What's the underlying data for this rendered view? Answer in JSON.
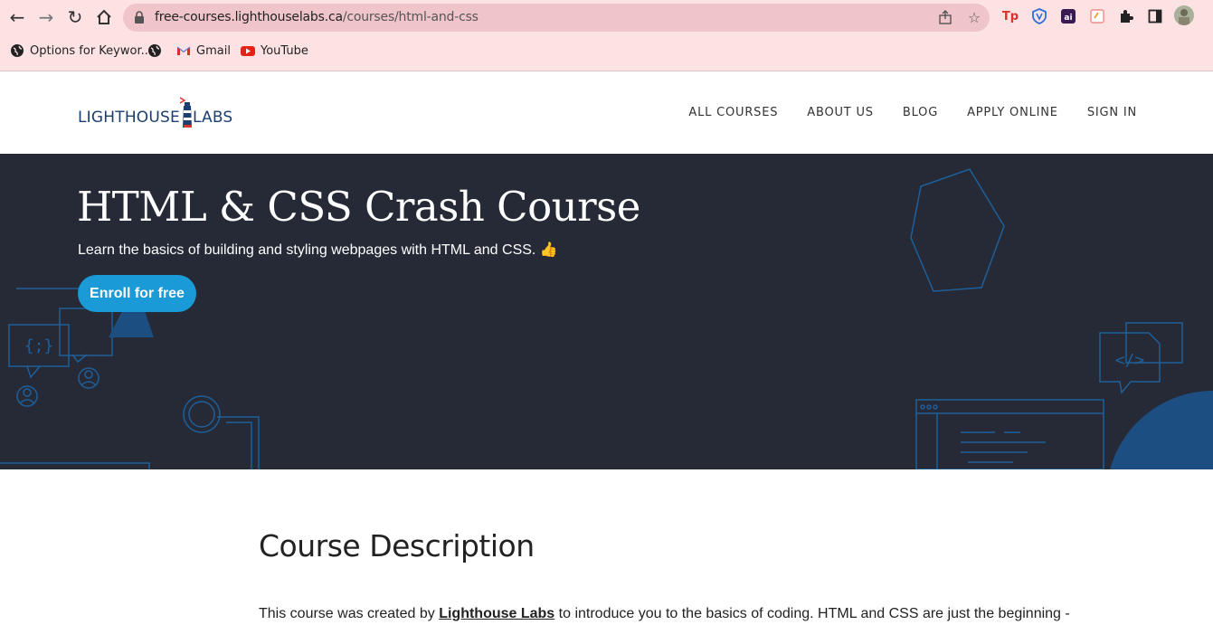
{
  "browser": {
    "url_domain": "free-courses.lighthouselabs.ca",
    "url_path": "/courses/html-and-css",
    "extensions": [
      "Tp",
      "shield-ext",
      "ai-ext",
      "note-ext"
    ],
    "bookmarks": [
      {
        "label": "Options for Keywor...",
        "icon": "globe-icon"
      },
      {
        "label": "",
        "icon": "globe-icon"
      },
      {
        "label": "Gmail",
        "icon": "gmail-icon"
      },
      {
        "label": "YouTube",
        "icon": "youtube-icon"
      }
    ]
  },
  "site": {
    "logo_left": "LIGHTHOUSE",
    "logo_right": "LABS",
    "nav": [
      "ALL COURSES",
      "ABOUT US",
      "BLOG",
      "APPLY ONLINE",
      "SIGN IN"
    ]
  },
  "hero": {
    "title": "HTML & CSS Crash Course",
    "subtitle": "Learn the basics of building and styling webpages with HTML and CSS. 👍",
    "cta": "Enroll for free",
    "colors": {
      "background": "#262a36",
      "accent": "#1a9ad6",
      "line": "#1f5f99"
    }
  },
  "content": {
    "heading": "Course Description",
    "text_before": "This course was created by ",
    "link": "Lighthouse Labs",
    "text_after": " to introduce you to the basics of coding. HTML and CSS are just the beginning -"
  }
}
